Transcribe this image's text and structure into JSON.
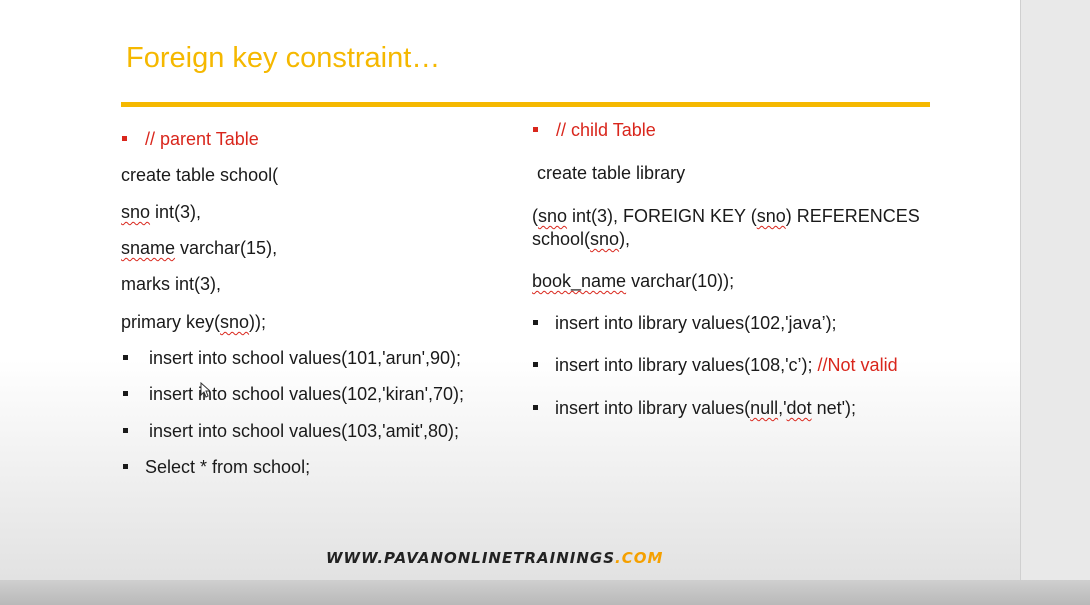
{
  "title": "Foreign key constraint…",
  "left": {
    "heading": "// parent Table",
    "create": "create table school(",
    "col1_name": "sno",
    "col1_rest": " int(3),",
    "col2_name": "sname",
    "col2_rest": " varchar(15),",
    "col3": "marks int(3),",
    "pk_pre": "primary key(",
    "pk_name": "sno",
    "pk_post": "));",
    "inserts": [
      "insert into school values(101,'arun',90);",
      "insert into school values(102,'kiran',70);",
      "insert into school values(103,'amit',80);"
    ],
    "select": "Select * from school;"
  },
  "right": {
    "heading": "// child Table",
    "create": "create table library",
    "fk_pre": "(",
    "fk_sno1": "sno",
    "fk_mid": " int(3),  FOREIGN KEY (",
    "fk_sno2": "sno",
    "fk_post": ") REFERENCES",
    "fk_line2_pre": "school(",
    "fk_line2_sno": "sno",
    "fk_line2_post": "),",
    "book_name": "book_name",
    "book_rest": " varchar(10));",
    "insert1": "insert into library values(102,'java’);",
    "insert2": "insert into library values(108,'c’); ",
    "insert2_note": "//Not valid",
    "insert3_pre": "insert into library values(",
    "insert3_null": "null",
    "insert3_mid": ",'",
    "insert3_dot": "dot",
    "insert3_post": " net');"
  },
  "footer": {
    "main": "WWW.PAVANONLINETRAININGS",
    "dom": ".COM"
  },
  "colors": {
    "accent": "#f5b800",
    "red": "#d9261c"
  }
}
